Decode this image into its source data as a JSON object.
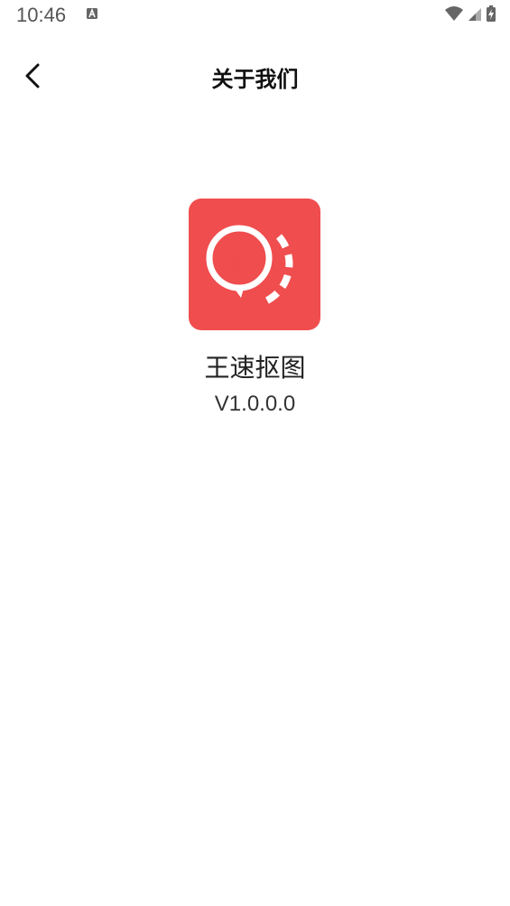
{
  "status_bar": {
    "time": "10:46",
    "notification_icon": "a-icon",
    "wifi_icon": "wifi-icon",
    "signal_icon": "signal-icon",
    "battery_icon": "battery-charging-icon"
  },
  "header": {
    "back_icon": "chevron-left-icon",
    "title": "关于我们"
  },
  "app": {
    "logo_icon": "scissors-cutout-icon",
    "logo_color": "#f04d4e",
    "name": "王速抠图",
    "version": "V1.0.0.0"
  }
}
